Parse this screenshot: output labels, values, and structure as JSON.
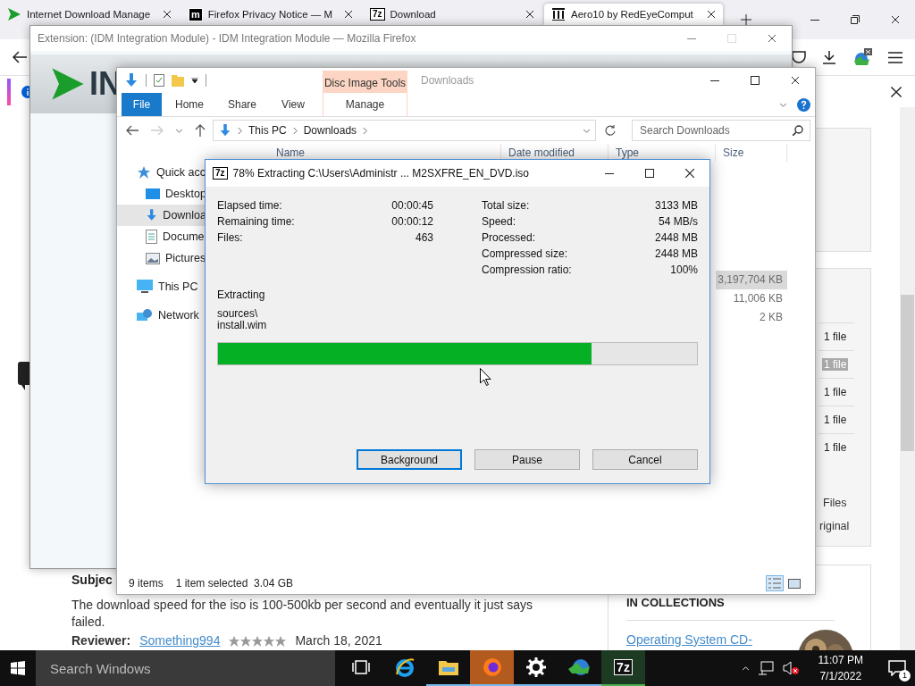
{
  "browser": {
    "tabs": [
      {
        "title": "Internet Download Manage",
        "selected": false
      },
      {
        "title": "Firefox Privacy Notice — M",
        "badge": "m",
        "selected": false
      },
      {
        "title": "Download",
        "badge": "7z",
        "selected": false
      },
      {
        "title": "Aero10 by RedEyeComput",
        "selected": true
      }
    ]
  },
  "page": {
    "subject": "Subjec",
    "review_text": "The download speed for the iso is 100-500kb per second and eventually it just says",
    "review_text_end": "failed.",
    "reviewer_label": "Reviewer:",
    "reviewer_name": "Something994",
    "stars": 5,
    "review_date": "March 18, 2021",
    "files": [
      {
        "label": "1 file",
        "selected": false
      },
      {
        "label": "1 file",
        "selected": true
      },
      {
        "label": "1 file",
        "selected": false
      },
      {
        "label": "1 file",
        "selected": false
      },
      {
        "label": "1 file",
        "selected": false
      }
    ],
    "files_link": "Files",
    "original_link": "riginal",
    "collections_title": "IN COLLECTIONS",
    "collection_link": "Operating System CD-"
  },
  "extension_window": {
    "title": "Extension: (IDM Integration Module) - IDM Integration Module — Mozilla Firefox",
    "banner": "IN"
  },
  "explorer": {
    "context_group": "Disc Image Tools",
    "title": "Downloads",
    "ribbon_tabs": [
      {
        "label": "File",
        "kind": "file"
      },
      {
        "label": "Home",
        "kind": "tab"
      },
      {
        "label": "Share",
        "kind": "tab"
      },
      {
        "label": "View",
        "kind": "tab"
      },
      {
        "label": "Manage",
        "kind": "context"
      }
    ],
    "breadcrumb": [
      "This PC",
      "Downloads"
    ],
    "search": {
      "placeholder": "Search Downloads"
    },
    "nav": [
      {
        "label": "Quick acc",
        "selected": false,
        "children": [
          {
            "label": "Desktop",
            "selected": false
          },
          {
            "label": "Downloa",
            "selected": true
          },
          {
            "label": "Docume",
            "selected": false
          },
          {
            "label": "Pictures",
            "selected": false
          }
        ]
      },
      {
        "label": "This PC",
        "selected": false
      },
      {
        "label": "Network",
        "selected": false
      }
    ],
    "columns": [
      "Name",
      "Date modified",
      "Type",
      "Size"
    ],
    "sizes": [
      {
        "value": "3,197,704 KB",
        "selected": true
      },
      {
        "value": "11,006 KB",
        "selected": false
      },
      {
        "value": "2 KB",
        "selected": false
      }
    ],
    "status": {
      "count": "9 items",
      "selection": "1 item selected  3.04 GB"
    }
  },
  "dialog": {
    "icon_text": "7z",
    "title": "78% Extracting C:\\Users\\Administr ... M2SXFRE_EN_DVD.iso",
    "left_stats": [
      {
        "label": "Elapsed time:",
        "value": "00:00:45"
      },
      {
        "label": "Remaining time:",
        "value": "00:00:12"
      },
      {
        "label": "Files:",
        "value": "463"
      }
    ],
    "right_stats": [
      {
        "label": "Total size:",
        "value": "3133 MB"
      },
      {
        "label": "Speed:",
        "value": "54 MB/s"
      },
      {
        "label": "Processed:",
        "value": "2448 MB"
      },
      {
        "label": "Compressed size:",
        "value": "2448 MB"
      },
      {
        "label": "Compression ratio:",
        "value": "100%"
      }
    ],
    "operation": "Extracting",
    "path_lines": [
      "sources\\",
      "install.wim"
    ],
    "progress": {
      "level": 0.78
    },
    "buttons": [
      {
        "label": "Background",
        "focused": true
      },
      {
        "label": "Pause",
        "focused": false
      },
      {
        "label": "Cancel",
        "focused": false
      }
    ]
  },
  "taskbar": {
    "search": {
      "placeholder": "Search Windows"
    },
    "apps": [
      {
        "running": false,
        "active": false
      },
      {
        "running": false,
        "active": false
      },
      {
        "running": true,
        "active": false
      },
      {
        "running": true,
        "active": true
      },
      {
        "running": true,
        "active": false
      },
      {
        "running": true,
        "active": false
      },
      {
        "badge": "7z",
        "running": true,
        "active": true
      }
    ],
    "clock": {
      "time": "11:07 PM",
      "date": "7/1/2022"
    },
    "notifications": "1"
  }
}
